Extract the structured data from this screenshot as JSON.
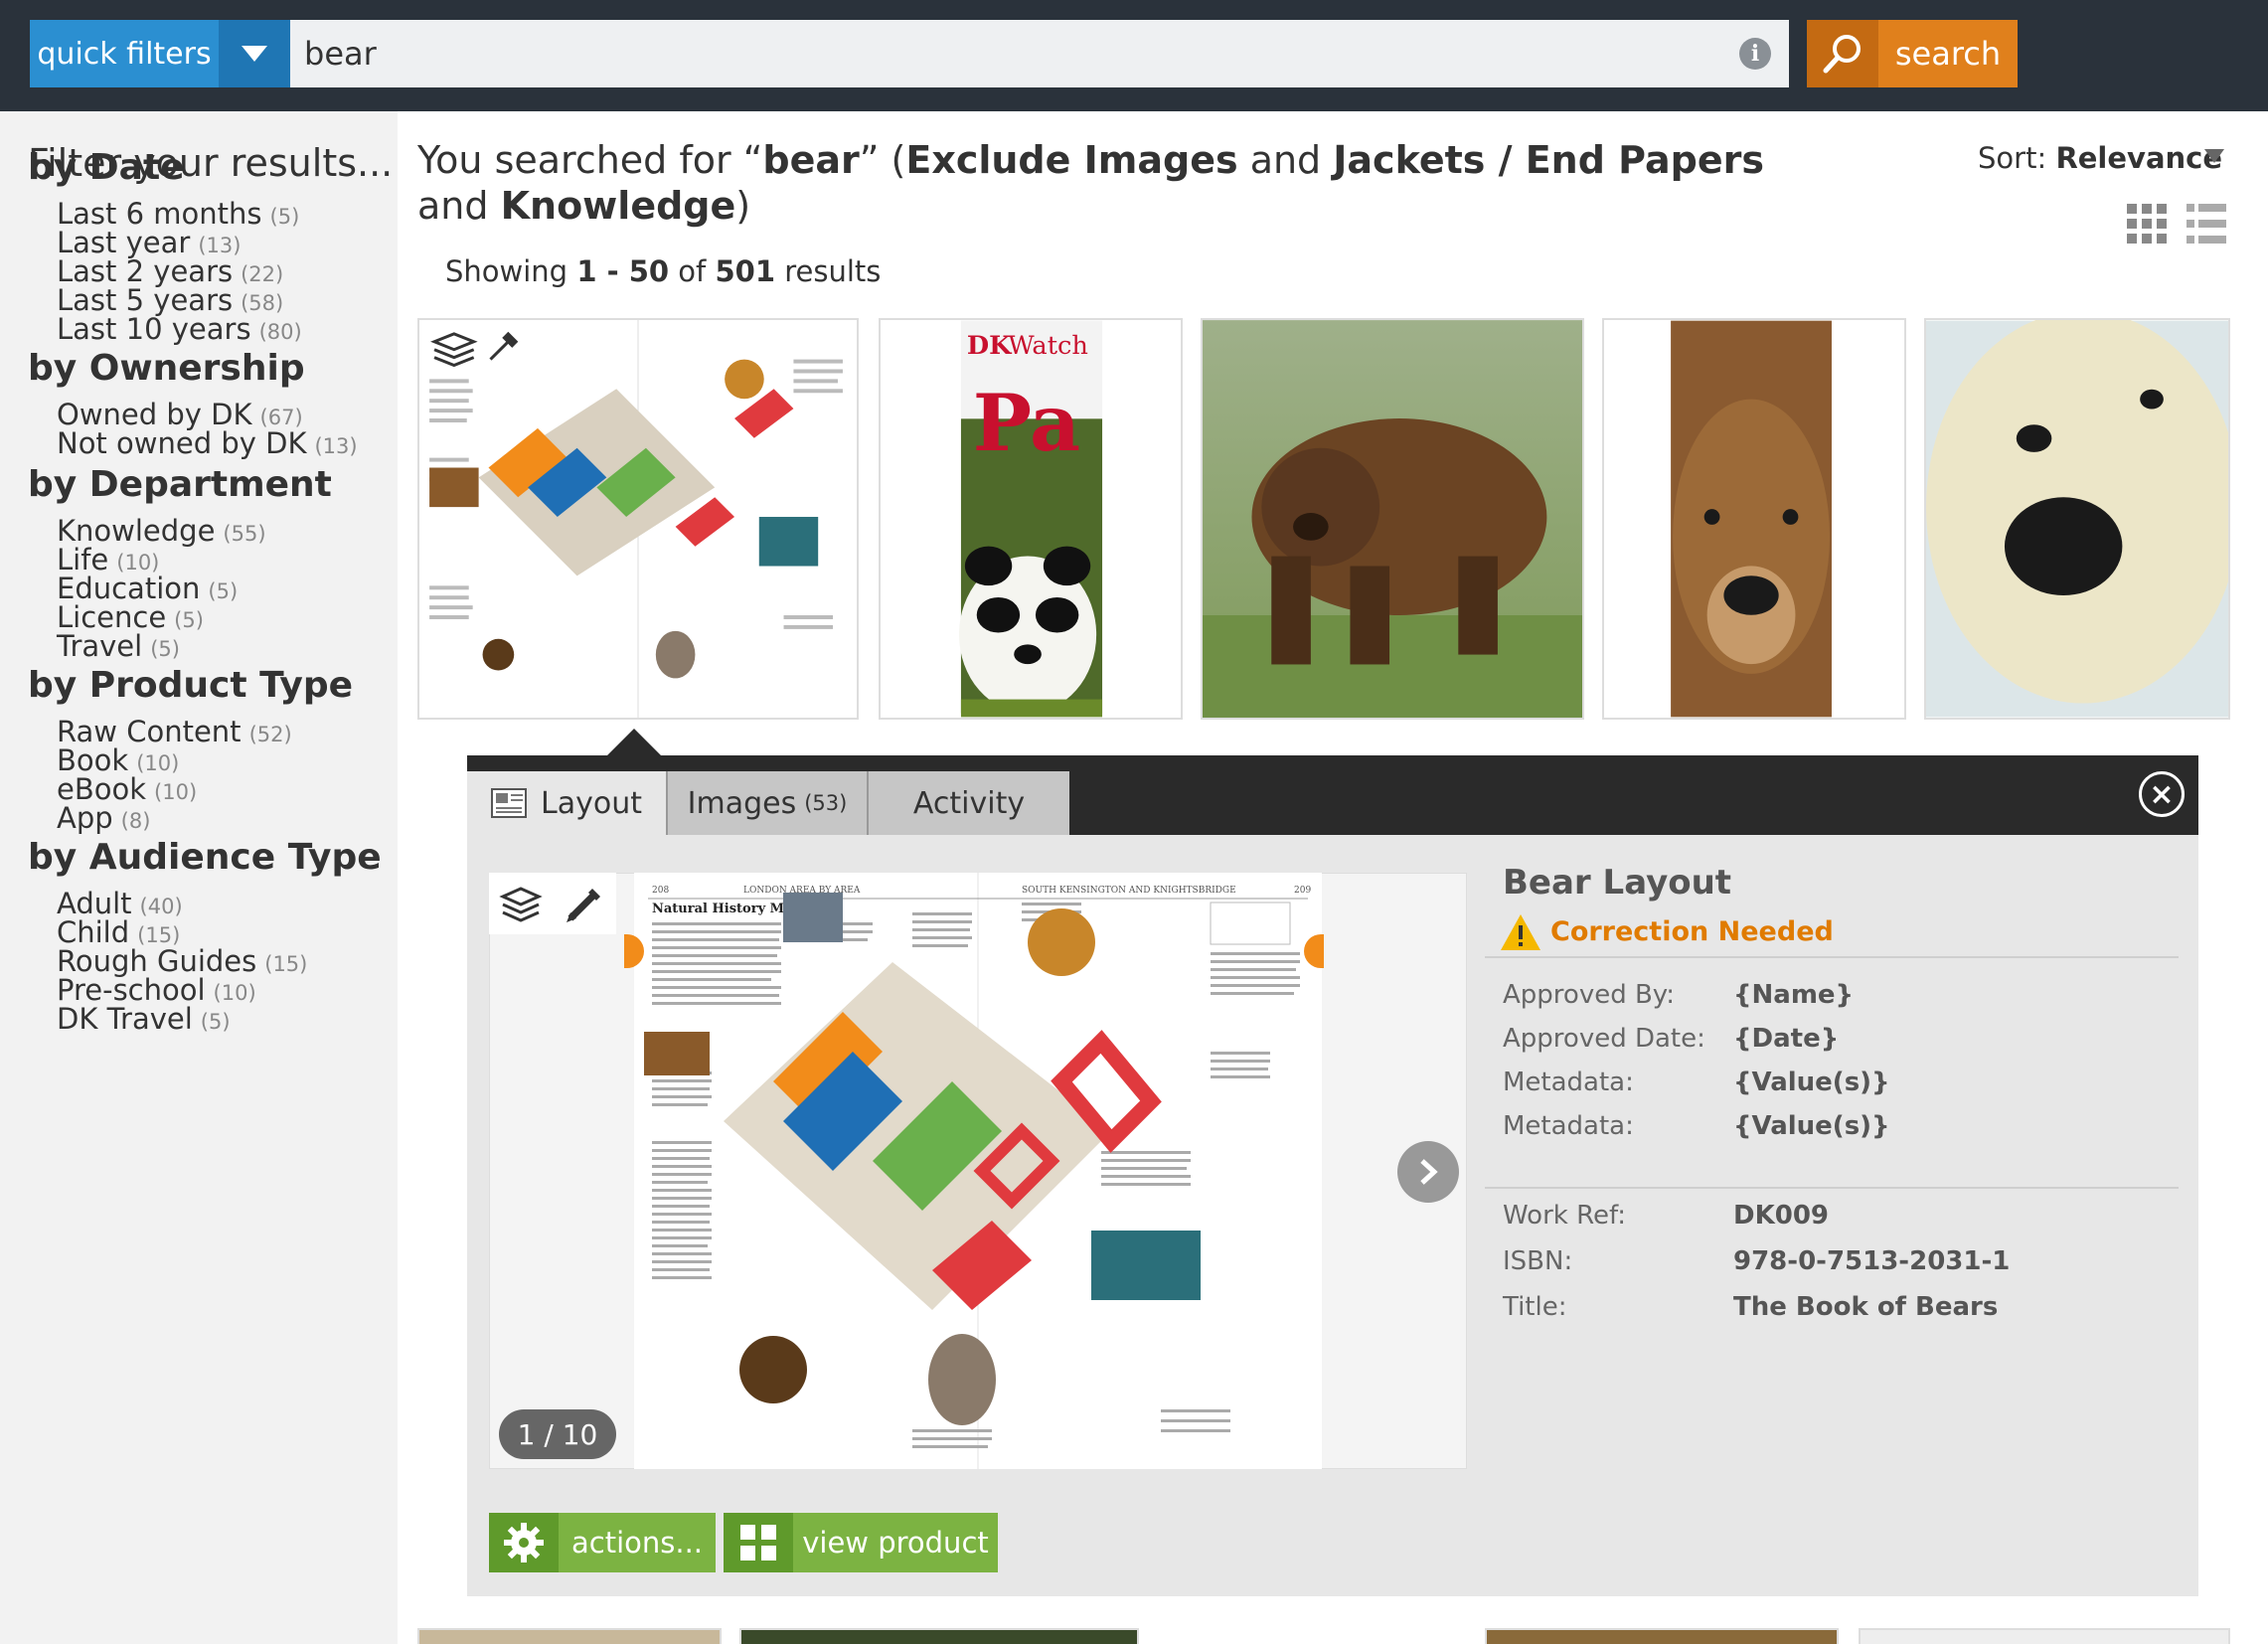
{
  "topbar": {
    "quick_filters_label": "quick filters",
    "search_value": "bear",
    "search_button_label": "search"
  },
  "sidebar": {
    "title": "Filter your results...",
    "groups": [
      {
        "heading": "by Date",
        "items": [
          {
            "label": "Last 6 months",
            "count": "(5)"
          },
          {
            "label": "Last year",
            "count": "(13)"
          },
          {
            "label": "Last 2 years",
            "count": "(22)"
          },
          {
            "label": "Last 5 years",
            "count": "(58)"
          },
          {
            "label": "Last 10 years",
            "count": "(80)"
          }
        ]
      },
      {
        "heading": "by Ownership",
        "items": [
          {
            "label": "Owned by DK",
            "count": "(67)"
          },
          {
            "label": "Not owned by DK",
            "count": "(13)"
          }
        ]
      },
      {
        "heading": "by Department",
        "items": [
          {
            "label": "Knowledge",
            "count": "(55)"
          },
          {
            "label": "Life",
            "count": "(10)"
          },
          {
            "label": "Education",
            "count": "(5)"
          },
          {
            "label": "Licence",
            "count": "(5)"
          },
          {
            "label": "Travel",
            "count": "(5)"
          }
        ]
      },
      {
        "heading": "by Product Type",
        "items": [
          {
            "label": "Raw Content",
            "count": "(52)"
          },
          {
            "label": "Book",
            "count": "(10)"
          },
          {
            "label": "eBook",
            "count": "(10)"
          },
          {
            "label": "App",
            "count": "(8)"
          }
        ]
      },
      {
        "heading": "by Audience Type",
        "items": [
          {
            "label": "Adult",
            "count": "(40)"
          },
          {
            "label": "Child",
            "count": "(15)"
          },
          {
            "label": "Rough Guides",
            "count": "(15)"
          },
          {
            "label": "Pre-school",
            "count": "(10)"
          },
          {
            "label": "DK Travel",
            "count": "(5)"
          }
        ]
      }
    ]
  },
  "results": {
    "heading_prefix": "You searched for “",
    "query": "bear",
    "heading_mid1": "” (",
    "filter1": "Exclude Images",
    "and1": " and ",
    "filter2": "Jackets / End Papers",
    "and2": " and ",
    "filter3": "Knowledge",
    "heading_suffix": ")",
    "showing_prefix": "Showing ",
    "range": "1 - 50",
    "of": " of ",
    "total": "501",
    "results_word": " results",
    "sort_label": "Sort:",
    "sort_value": "Relevance"
  },
  "thumbnails": [
    {
      "kind": "layout",
      "name": "thumb-layout-spread"
    },
    {
      "kind": "book",
      "name": "thumb-panda-book",
      "brand": "DK",
      "series": "Watch",
      "title": "Pa"
    },
    {
      "kind": "photo",
      "name": "thumb-brown-bear"
    },
    {
      "kind": "photo",
      "name": "thumb-bear-face"
    },
    {
      "kind": "photo",
      "name": "thumb-polar-bear"
    }
  ],
  "panel": {
    "tabs": [
      {
        "label": "Layout",
        "count": ""
      },
      {
        "label": "Images",
        "count": "(53)"
      },
      {
        "label": "Activity",
        "count": ""
      }
    ],
    "page_badge": "1 / 10",
    "actions_label": "actions...",
    "view_label": "view product",
    "info": {
      "title": "Bear Layout",
      "status": "Correction Needed",
      "status_color": "#e07b00",
      "meta": [
        {
          "label": "Approved By:",
          "value": "{Name}"
        },
        {
          "label": "Approved Date:",
          "value": "{Date}"
        },
        {
          "label": "Metadata:",
          "value": "{Value(s)}"
        },
        {
          "label": "Metadata:",
          "value": "{Value(s)}"
        }
      ],
      "details": [
        {
          "label": "Work Ref:",
          "value": "DK009"
        },
        {
          "label": "ISBN:",
          "value": "978-0-7513-2031-1"
        },
        {
          "label": "Title:",
          "value": "The Book of Bears"
        }
      ]
    },
    "spread": {
      "page_left": "208",
      "running_left": "LONDON AREA BY AREA",
      "running_right": "SOUTH KENSINGTON AND KNIGHTSBRIDGE",
      "page_right": "209",
      "heading": "Natural History Museum"
    }
  },
  "colors": {
    "topbar": "#2a323b",
    "quick_filters": "#2b8fd1",
    "search": "#e0801c",
    "action_green": "#7cb342"
  }
}
